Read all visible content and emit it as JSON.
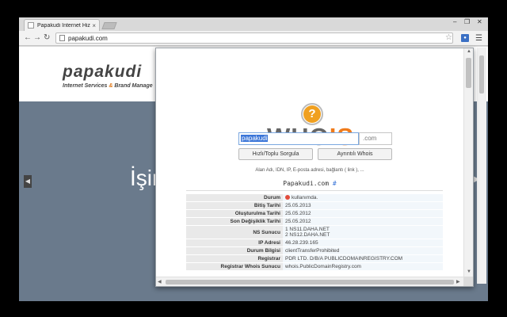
{
  "browser": {
    "tab_title": "Papakudi Internet Hizmetl",
    "tab_close": "×",
    "url": "papakudi.com",
    "window_controls": [
      "–",
      "❐",
      "✕"
    ]
  },
  "site": {
    "logo_text": "papakudi",
    "logo_sub_prefix": "Internet Services",
    "logo_sub_amp": "&",
    "logo_sub_suffix": "Brand Manage",
    "hero_text": "İşin"
  },
  "whois": {
    "logo_gray": "WHO",
    "logo_orange": "IS",
    "logo_mark": "?",
    "domain_value": "papakudi",
    "tld_value": ".com",
    "quick_button": "Hızlı/Toplu Sorgula",
    "detail_button": "Ayrıntılı Whois",
    "hint": "Alan Adı, IDN, IP, E-posta adresi, bağlantı ( link ), ...",
    "result_domain": "Papakudi.com",
    "result_hash": "#",
    "rows": [
      {
        "key": "Durum",
        "value": "kullanımda."
      },
      {
        "key": "Bitiş Tarihi",
        "value": "25.05.2013"
      },
      {
        "key": "Oluşturulma Tarihi",
        "value": "25.05.2012"
      },
      {
        "key": "Son Değişiklik Tarihi",
        "value": "25.05.2012"
      },
      {
        "key": "NS Sunucu",
        "value": "1 NS11.DAHA.NET",
        "value2": "2 NS12.DAHA.NET"
      },
      {
        "key": "IP Adresi",
        "value": "46.28.239.165"
      },
      {
        "key": "Durum Bilgisi",
        "value": "clientTransferProhibited"
      },
      {
        "key": "Registrar",
        "value": "PDR LTD. D/B/A PUBLICDOMAINREGISTRY.COM"
      },
      {
        "key": "Registrar Whois Sunucu",
        "value": "whois.PublicDomainRegistry.com"
      }
    ]
  },
  "colors": {
    "accent_orange": "#f07b1b",
    "logo_gray": "#666666",
    "status_red": "#e24c3c",
    "hero_bg": "#6a7a8c"
  }
}
